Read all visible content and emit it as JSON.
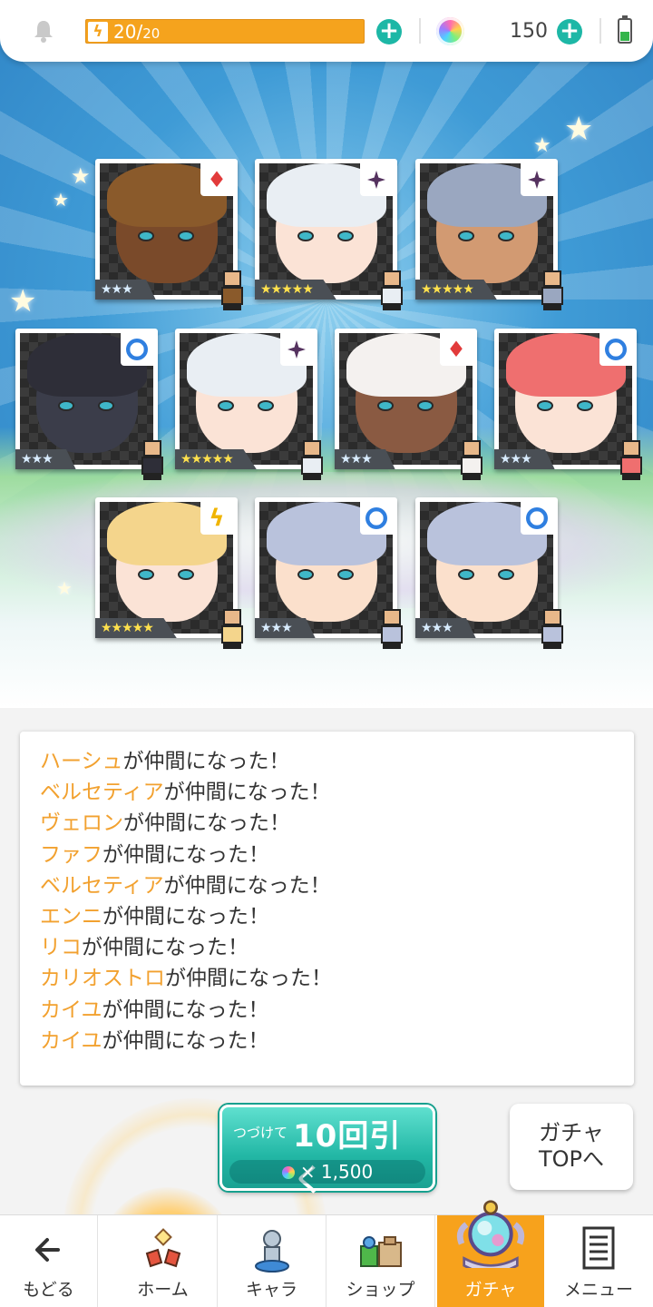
{
  "status_bar": {
    "stamina_current": "20",
    "stamina_max": "20",
    "stamina_fill": 1.0,
    "gem_count": "150",
    "bell_icon": "bell-icon",
    "battery_icon": "battery-icon"
  },
  "cards": [
    {
      "rarity": "★★★",
      "stars": 3,
      "attribute": "fire",
      "attr_icon": "diamond-fire-icon",
      "hair": "#8a5a2b",
      "skin": "#7a4a2a"
    },
    {
      "rarity": "★★★★★",
      "stars": 5,
      "attribute": "dark",
      "attr_icon": "sparkle-dark-icon",
      "hair": "#e9eef3",
      "skin": "#fbe3d6"
    },
    {
      "rarity": "★★★★★",
      "stars": 5,
      "attribute": "dark",
      "attr_icon": "sparkle-dark-icon",
      "hair": "#9aa7c0",
      "skin": "#d29a72"
    },
    {
      "rarity": "★★★",
      "stars": 3,
      "attribute": "water",
      "attr_icon": "circle-water-icon",
      "hair": "#2e2e38",
      "skin": "#3b3d4a"
    },
    {
      "rarity": "★★★★★",
      "stars": 5,
      "attribute": "dark",
      "attr_icon": "sparkle-dark-icon",
      "hair": "#e9eef3",
      "skin": "#fbe3d6"
    },
    {
      "rarity": "★★★",
      "stars": 3,
      "attribute": "fire",
      "attr_icon": "diamond-fire-icon",
      "hair": "#f4f1ef",
      "skin": "#8a5a42"
    },
    {
      "rarity": "★★★",
      "stars": 3,
      "attribute": "water",
      "attr_icon": "circle-water-icon",
      "hair": "#ef6f6f",
      "skin": "#fbe3d6"
    },
    {
      "rarity": "★★★★★",
      "stars": 5,
      "attribute": "thunder",
      "attr_icon": "lightning-thunder-icon",
      "hair": "#f4d58c",
      "skin": "#fbe3d6"
    },
    {
      "rarity": "★★★",
      "stars": 3,
      "attribute": "water",
      "attr_icon": "circle-water-icon",
      "hair": "#b9c2dc",
      "skin": "#fbe0cc"
    },
    {
      "rarity": "★★★",
      "stars": 3,
      "attribute": "water",
      "attr_icon": "circle-water-icon",
      "hair": "#b9c2dc",
      "skin": "#fbe0cc"
    }
  ],
  "results": [
    {
      "name": "ハーシュ",
      "suffix": "が仲間になった！"
    },
    {
      "name": "ベルセティア",
      "suffix": "が仲間になった！"
    },
    {
      "name": "ヴェロン",
      "suffix": "が仲間になった！"
    },
    {
      "name": "ファフ",
      "suffix": "が仲間になった！"
    },
    {
      "name": "ベルセティア",
      "suffix": "が仲間になった！"
    },
    {
      "name": "エンニ",
      "suffix": "が仲間になった！"
    },
    {
      "name": "リコ",
      "suffix": "が仲間になった！"
    },
    {
      "name": "カリオストロ",
      "suffix": "が仲間になった！"
    },
    {
      "name": "カイユ",
      "suffix": "が仲間になった！"
    },
    {
      "name": "カイユ",
      "suffix": "が仲間になった！"
    }
  ],
  "actions": {
    "pull_prefix": "つづけて",
    "pull_main": "10回引く",
    "pull_cost": "× 1,500",
    "gacha_top_line1": "ガチャ",
    "gacha_top_line2": "TOPへ"
  },
  "nav": {
    "back": "もどる",
    "home": "ホーム",
    "chara": "キャラ",
    "shop": "ショップ",
    "gacha": "ガチャ",
    "menu": "メニュー"
  },
  "colors": {
    "accent_orange": "#f7a21c",
    "accent_teal": "#1db7a6",
    "name_highlight": "#f2a12f"
  }
}
